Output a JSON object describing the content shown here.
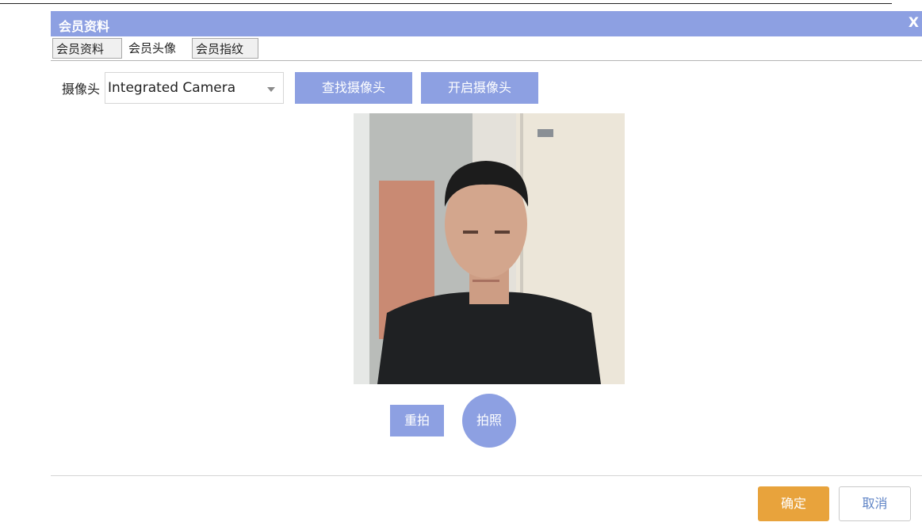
{
  "dialog": {
    "title": "会员资料",
    "close_label": "X"
  },
  "tabs": [
    {
      "label": "会员资料",
      "active": false
    },
    {
      "label": "会员头像",
      "active": true
    },
    {
      "label": "会员指纹",
      "active": false
    }
  ],
  "camera": {
    "label": "摄像头",
    "selected": "Integrated Camera",
    "find_button": "查找摄像头",
    "open_button": "开启摄像头"
  },
  "capture": {
    "retake_button": "重拍",
    "shoot_button": "拍照"
  },
  "footer": {
    "ok_button": "确定",
    "cancel_button": "取消"
  },
  "colors": {
    "accent": "#8da0e2",
    "confirm": "#e8a33c",
    "cancel_text": "#5f84c6"
  }
}
